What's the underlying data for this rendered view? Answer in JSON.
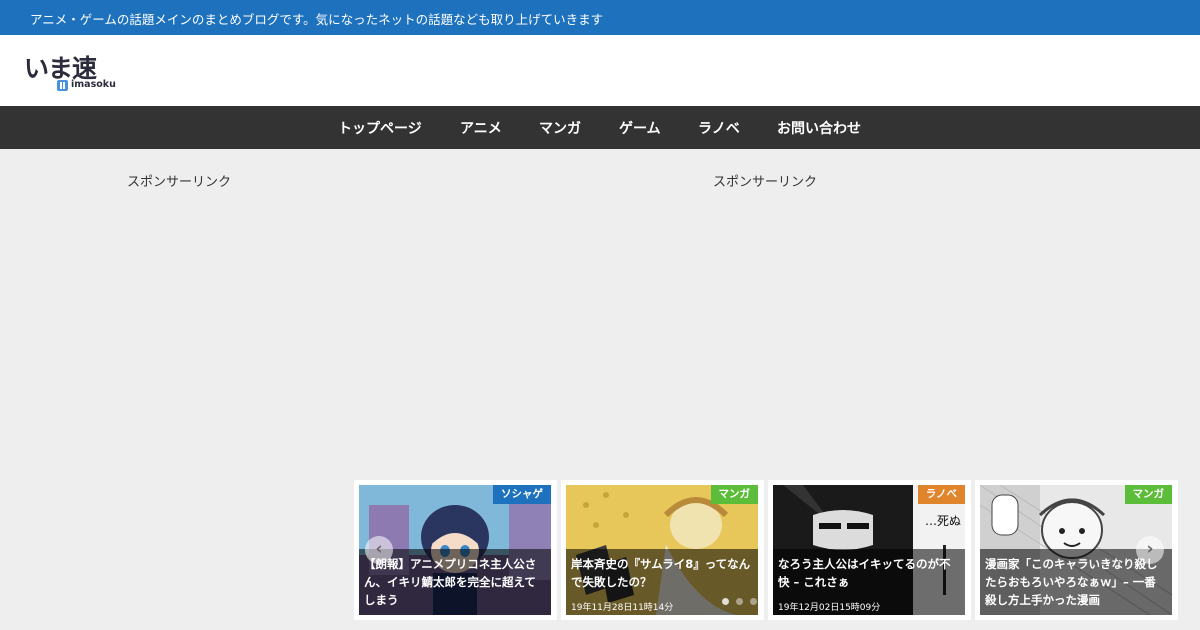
{
  "topbar": {
    "tagline": "アニメ・ゲームの話題メインのまとめブログです。気になったネットの話題なども取り上げていきます"
  },
  "logo": {
    "main": "いま速",
    "sub": "imasoku"
  },
  "nav": {
    "items": [
      "トップページ",
      "アニメ",
      "マンガ",
      "ゲーム",
      "ラノベ",
      "お問い合わせ"
    ]
  },
  "sponsor": {
    "left": "スポンサーリンク",
    "right": "スポンサーリンク"
  },
  "carousel": {
    "cards": [
      {
        "category": "ソシャゲ",
        "category_color": "#1e72bd",
        "title": "【朗報】アニメプリコネ主人公さん、イキリ鯖太郎を完全に超えてしまう",
        "date": ""
      },
      {
        "category": "マンガ",
        "category_color": "#5bbd3a",
        "title": "岸本斉史の『サムライ8』ってなんで失敗したの？",
        "date": "19年11月28日11時14分"
      },
      {
        "category": "ラノベ",
        "category_color": "#e0852c",
        "title": "なろう主人公はイキッてるのが不快 – これさぁ",
        "date": "19年12月02日15時09分"
      },
      {
        "category": "マンガ",
        "category_color": "#5bbd3a",
        "title": "漫画家「このキャラいきなり殺したらおもろいやろなぁｗ」– 一番殺し方上手かった漫画",
        "date": ""
      }
    ],
    "prev_icon": "chevron-left-icon",
    "next_icon": "chevron-right-icon"
  },
  "colors": {
    "topbar": "#1e72bd",
    "nav": "#333333",
    "background": "#eeeeee"
  }
}
